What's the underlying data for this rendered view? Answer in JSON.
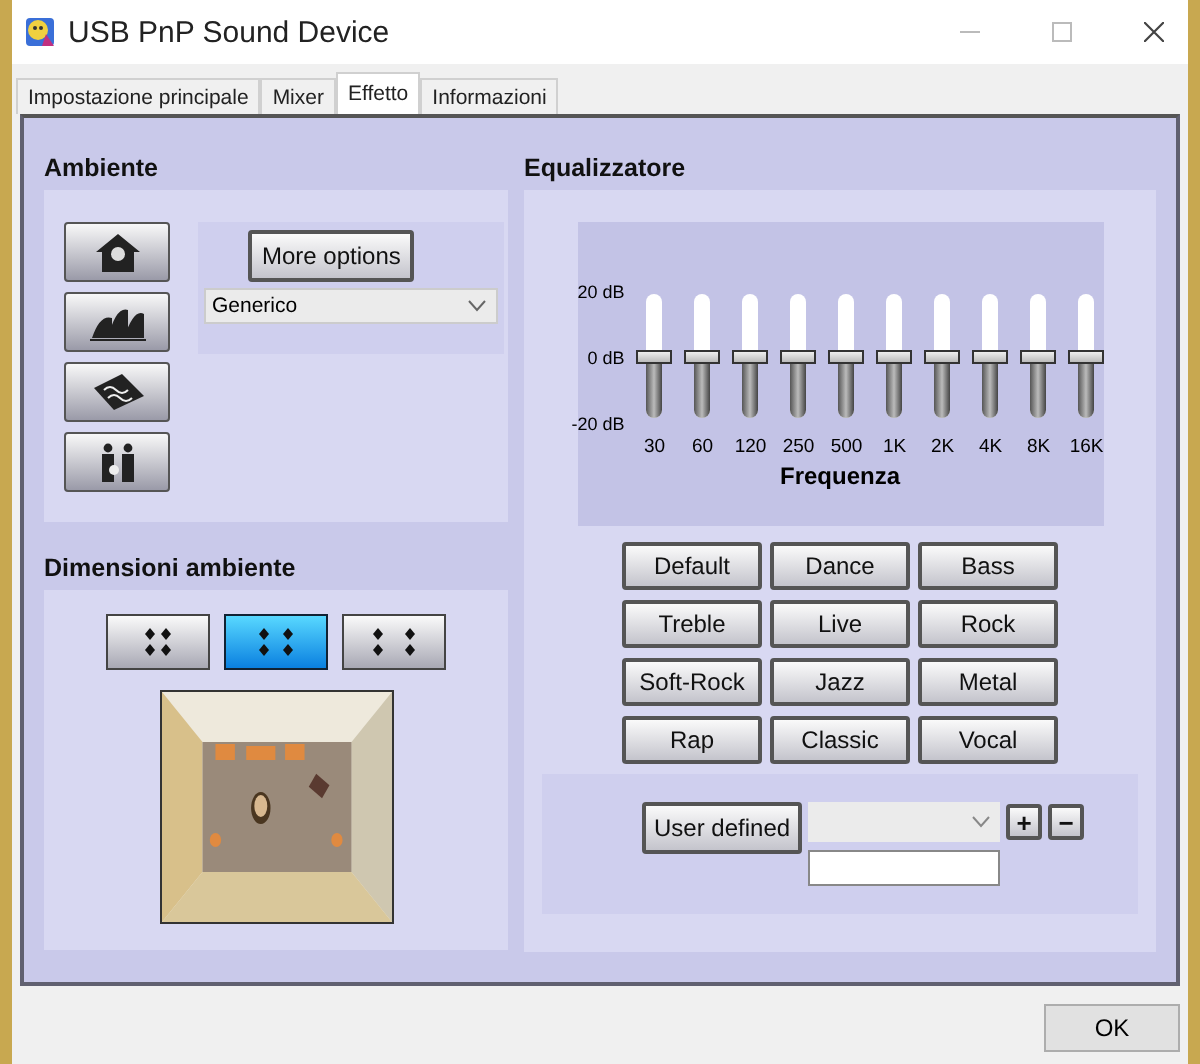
{
  "window": {
    "title": "USB PnP Sound Device"
  },
  "tabs": [
    {
      "label": "Impostazione principale",
      "selected": false
    },
    {
      "label": "Mixer",
      "selected": false
    },
    {
      "label": "Effetto",
      "selected": true
    },
    {
      "label": "Informazioni",
      "selected": false
    }
  ],
  "ambiente": {
    "title": "Ambiente",
    "more_options": "More options",
    "environment": "Generico"
  },
  "room": {
    "title": "Dimensioni ambiente",
    "sizes": [
      {
        "selected": false
      },
      {
        "selected": true
      },
      {
        "selected": false
      }
    ]
  },
  "equalizer": {
    "title": "Equalizzatore",
    "scale": [
      "20 dB",
      "0 dB",
      "-20 dB"
    ],
    "bands": [
      {
        "label": "30",
        "level": 0.5
      },
      {
        "label": "60",
        "level": 0.5
      },
      {
        "label": "120",
        "level": 0.5
      },
      {
        "label": "250",
        "level": 0.5
      },
      {
        "label": "500",
        "level": 0.5
      },
      {
        "label": "1K",
        "level": 0.5
      },
      {
        "label": "2K",
        "level": 0.5
      },
      {
        "label": "4K",
        "level": 0.5
      },
      {
        "label": "8K",
        "level": 0.5
      },
      {
        "label": "16K",
        "level": 0.5
      }
    ],
    "axis_label": "Frequenza",
    "presets": [
      "Default",
      "Dance",
      "Bass",
      "Treble",
      "Live",
      "Rock",
      "Soft-Rock",
      "Jazz",
      "Metal",
      "Rap",
      "Classic",
      "Vocal"
    ],
    "user_defined": "User defined",
    "plus": "+",
    "minus": "−"
  },
  "ok": "OK"
}
